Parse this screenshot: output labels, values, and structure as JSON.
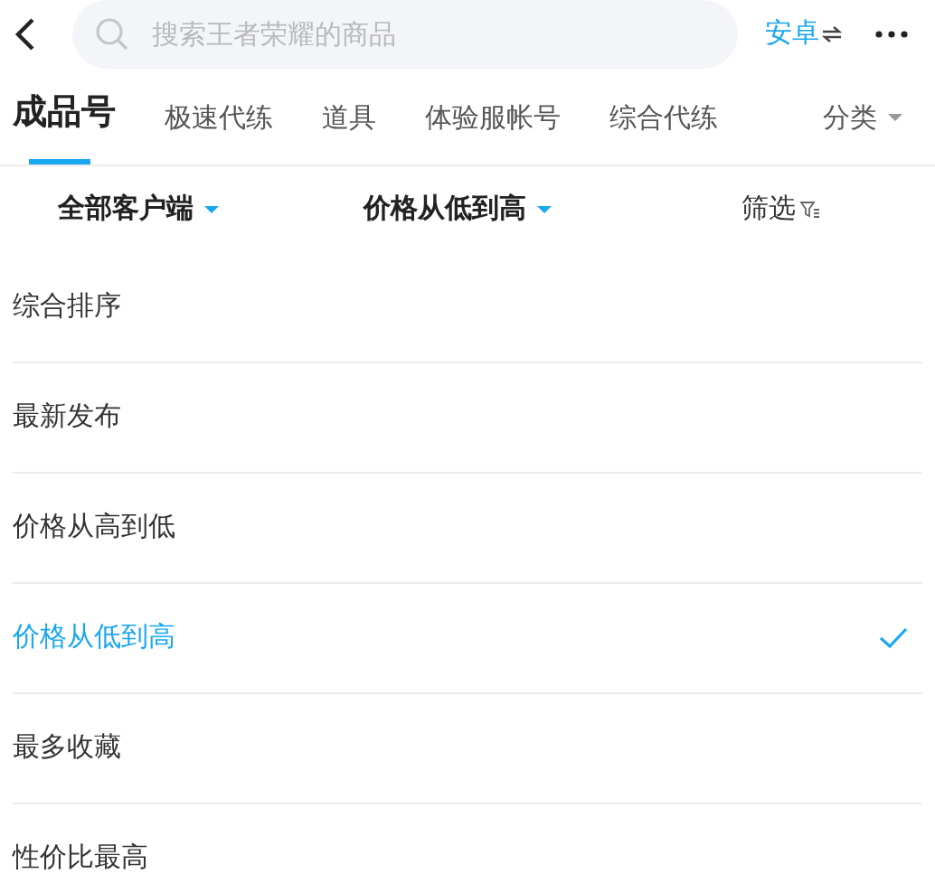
{
  "search": {
    "placeholder": "搜索王者荣耀的商品"
  },
  "platform": {
    "label": "安卓"
  },
  "tabs": [
    {
      "label": "成品号",
      "selected": true
    },
    {
      "label": "极速代练",
      "selected": false
    },
    {
      "label": "道具",
      "selected": false
    },
    {
      "label": "体验服帐号",
      "selected": false
    },
    {
      "label": "综合代练",
      "selected": false
    }
  ],
  "category": {
    "label": "分类"
  },
  "filters": [
    {
      "label": "全部客户端",
      "kind": "dropdown"
    },
    {
      "label": "价格从低到高",
      "kind": "dropdown"
    },
    {
      "label": "筛选",
      "kind": "filter"
    }
  ],
  "sort_options": [
    {
      "label": "综合排序",
      "selected": false
    },
    {
      "label": "最新发布",
      "selected": false
    },
    {
      "label": "价格从高到低",
      "selected": false
    },
    {
      "label": "价格从低到高",
      "selected": true
    },
    {
      "label": "最多收藏",
      "selected": false
    },
    {
      "label": "性价比最高",
      "selected": false
    }
  ]
}
